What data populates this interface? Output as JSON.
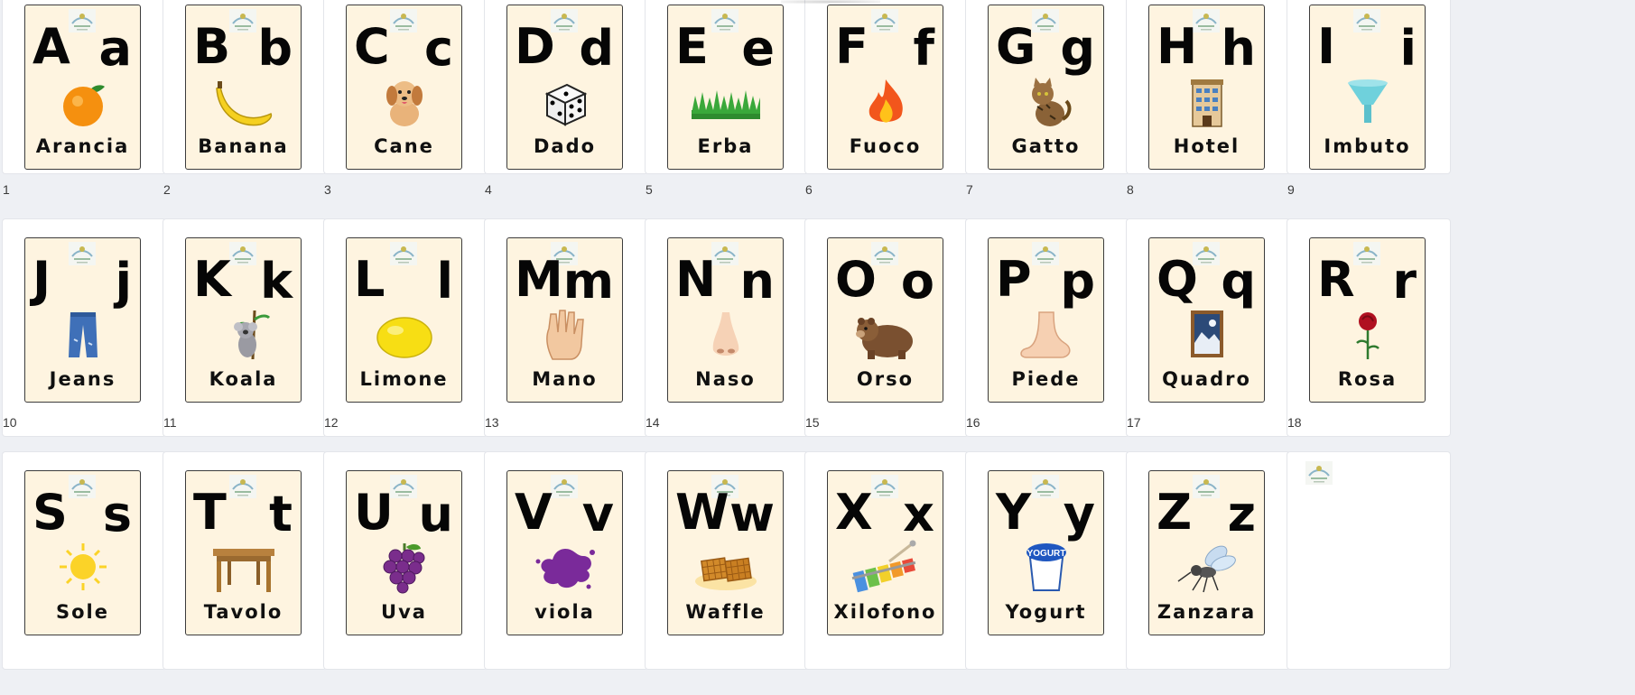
{
  "slides": [
    {
      "number": "1",
      "upper": "A",
      "lower": "a",
      "word": "Arancia",
      "icon": "orange-icon"
    },
    {
      "number": "2",
      "upper": "B",
      "lower": "b",
      "word": "Banana",
      "icon": "banana-icon"
    },
    {
      "number": "3",
      "upper": "C",
      "lower": "c",
      "word": "Cane",
      "icon": "dog-icon"
    },
    {
      "number": "4",
      "upper": "D",
      "lower": "d",
      "word": "Dado",
      "icon": "dice-icon"
    },
    {
      "number": "5",
      "upper": "E",
      "lower": "e",
      "word": "Erba",
      "icon": "grass-icon"
    },
    {
      "number": "6",
      "upper": "F",
      "lower": "f",
      "word": "Fuoco",
      "icon": "fire-icon"
    },
    {
      "number": "7",
      "upper": "G",
      "lower": "g",
      "word": "Gatto",
      "icon": "cat-icon"
    },
    {
      "number": "8",
      "upper": "H",
      "lower": "h",
      "word": "Hotel",
      "icon": "hotel-icon"
    },
    {
      "number": "9",
      "upper": "I",
      "lower": "i",
      "word": "Imbuto",
      "icon": "funnel-icon"
    },
    {
      "number": "10",
      "upper": "J",
      "lower": "j",
      "word": "Jeans",
      "icon": "jeans-icon"
    },
    {
      "number": "11",
      "upper": "K",
      "lower": "k",
      "word": "Koala",
      "icon": "koala-icon"
    },
    {
      "number": "12",
      "upper": "L",
      "lower": "l",
      "word": "Limone",
      "icon": "lemon-icon"
    },
    {
      "number": "13",
      "upper": "M",
      "lower": "m",
      "word": "Mano",
      "icon": "hand-icon"
    },
    {
      "number": "14",
      "upper": "N",
      "lower": "n",
      "word": "Naso",
      "icon": "nose-icon"
    },
    {
      "number": "15",
      "upper": "O",
      "lower": "o",
      "word": "Orso",
      "icon": "bear-icon"
    },
    {
      "number": "16",
      "upper": "P",
      "lower": "p",
      "word": "Piede",
      "icon": "foot-icon"
    },
    {
      "number": "17",
      "upper": "Q",
      "lower": "q",
      "word": "Quadro",
      "icon": "painting-icon"
    },
    {
      "number": "18",
      "upper": "R",
      "lower": "r",
      "word": "Rosa",
      "icon": "rose-icon"
    },
    {
      "number": "",
      "upper": "S",
      "lower": "s",
      "word": "Sole",
      "icon": "sun-icon"
    },
    {
      "number": "",
      "upper": "T",
      "lower": "t",
      "word": "Tavolo",
      "icon": "table-icon"
    },
    {
      "number": "",
      "upper": "U",
      "lower": "u",
      "word": "Uva",
      "icon": "grapes-icon"
    },
    {
      "number": "",
      "upper": "V",
      "lower": "v",
      "word": "viola",
      "icon": "violet-splash-icon"
    },
    {
      "number": "",
      "upper": "W",
      "lower": "w",
      "word": "Waffle",
      "icon": "waffle-icon"
    },
    {
      "number": "",
      "upper": "X",
      "lower": "x",
      "word": "Xilofono",
      "icon": "xylophone-icon"
    },
    {
      "number": "",
      "upper": "Y",
      "lower": "y",
      "word": "Yogurt",
      "icon": "yogurt-icon",
      "icon_text": "YOGURT"
    },
    {
      "number": "",
      "upper": "Z",
      "lower": "z",
      "word": "Zanzara",
      "icon": "mosquito-icon"
    }
  ],
  "blank_slide": {
    "icon": "logo-icon"
  },
  "colors": {
    "canvas": "#eef0f4",
    "slide": "#ffffff",
    "card": "#fef4e0",
    "card_border": "#3c3c3c",
    "text": "#060606"
  }
}
